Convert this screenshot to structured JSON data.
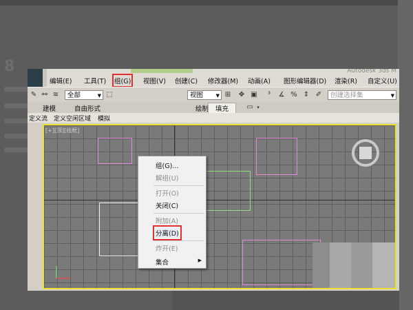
{
  "background": {
    "step_number": "8"
  },
  "title_partial": "Autodesk 3ds M",
  "menubar": {
    "items": [
      {
        "id": "edit",
        "label": "编辑(E)"
      },
      {
        "id": "tools",
        "label": "工具(T)"
      },
      {
        "id": "group",
        "label": "组(G)"
      },
      {
        "id": "views",
        "label": "视图(V)"
      },
      {
        "id": "create",
        "label": "创建(C)"
      },
      {
        "id": "modifiers",
        "label": "修改器(M)"
      },
      {
        "id": "animation",
        "label": "动画(A)"
      },
      {
        "id": "graph",
        "label": "图形编辑器(D)"
      },
      {
        "id": "render",
        "label": "渲染(R)"
      },
      {
        "id": "custom",
        "label": "自定义(U)"
      }
    ]
  },
  "toolbar": {
    "selection_filter": "全部",
    "view_dropdown": "视图",
    "named_set_placeholder": "创建选择集"
  },
  "ribbon": {
    "tabs": [
      {
        "id": "modeling",
        "label": "建模"
      },
      {
        "id": "freeform",
        "label": "自由形式"
      },
      {
        "id": "paint",
        "label": "绘制"
      },
      {
        "id": "populate",
        "label": "填充"
      }
    ]
  },
  "subbar": {
    "items": [
      {
        "id": "define-flow",
        "label": "定义流"
      },
      {
        "id": "define-idle",
        "label": "定义空闲区域"
      },
      {
        "id": "simulate",
        "label": "模拟"
      }
    ]
  },
  "viewport": {
    "label": "[+][顶][线框]"
  },
  "group_menu": {
    "items": [
      {
        "id": "group",
        "label": "组(G)...",
        "disabled": false
      },
      {
        "id": "ungroup",
        "label": "解组(U)",
        "disabled": true
      },
      {
        "id": "open",
        "label": "打开(O)",
        "disabled": true
      },
      {
        "id": "close",
        "label": "关闭(C)",
        "disabled": false
      },
      {
        "id": "attach",
        "label": "附加(A)",
        "disabled": true
      },
      {
        "id": "detach",
        "label": "分离(D)",
        "disabled": false
      },
      {
        "id": "explode",
        "label": "炸开(E)",
        "disabled": true
      },
      {
        "id": "assembly",
        "label": "集合",
        "disabled": false
      }
    ]
  },
  "colors": {
    "highlight": "#e03030",
    "viewport_border": "#e8e030",
    "rect_pink": "#e08ad8",
    "rect_green": "#8fdc7a",
    "rect_white": "#f4f4f4"
  }
}
